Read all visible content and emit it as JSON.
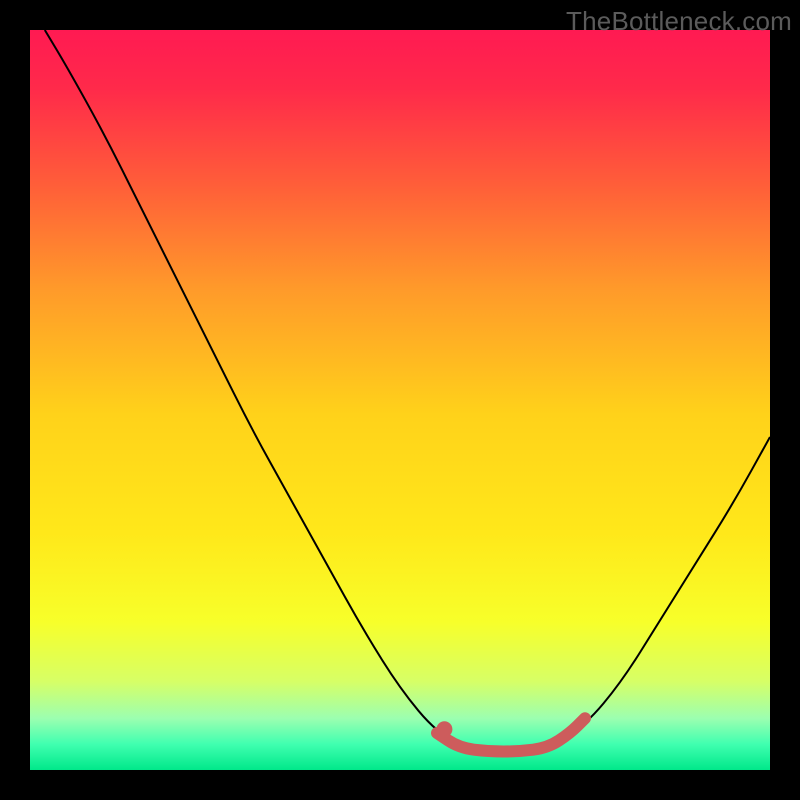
{
  "page": {
    "watermark": "TheBottleneck.com"
  },
  "chart_data": {
    "type": "line",
    "title": "",
    "xlabel": "",
    "ylabel": "",
    "xlim": [
      0,
      100
    ],
    "ylim": [
      0,
      100
    ],
    "grid": false,
    "axes_visible": false,
    "background": {
      "gradient_stops": [
        {
          "offset": 0.0,
          "color": "#ff1a52"
        },
        {
          "offset": 0.08,
          "color": "#ff2a4a"
        },
        {
          "offset": 0.2,
          "color": "#ff5a3a"
        },
        {
          "offset": 0.35,
          "color": "#ff9a2a"
        },
        {
          "offset": 0.52,
          "color": "#ffd21a"
        },
        {
          "offset": 0.68,
          "color": "#ffe81a"
        },
        {
          "offset": 0.8,
          "color": "#f7ff2a"
        },
        {
          "offset": 0.88,
          "color": "#d7ff66"
        },
        {
          "offset": 0.93,
          "color": "#9cffb0"
        },
        {
          "offset": 0.965,
          "color": "#40ffb0"
        },
        {
          "offset": 1.0,
          "color": "#00e88a"
        }
      ]
    },
    "series": [
      {
        "name": "bottleneck-curve",
        "color": "#000000",
        "width": 2,
        "points": [
          {
            "x": 2,
            "y": 100
          },
          {
            "x": 5,
            "y": 95
          },
          {
            "x": 10,
            "y": 86
          },
          {
            "x": 15,
            "y": 76
          },
          {
            "x": 20,
            "y": 66
          },
          {
            "x": 25,
            "y": 56
          },
          {
            "x": 30,
            "y": 46
          },
          {
            "x": 35,
            "y": 37
          },
          {
            "x": 40,
            "y": 28
          },
          {
            "x": 45,
            "y": 19
          },
          {
            "x": 50,
            "y": 11
          },
          {
            "x": 55,
            "y": 5
          },
          {
            "x": 60,
            "y": 2.5
          },
          {
            "x": 65,
            "y": 2.5
          },
          {
            "x": 70,
            "y": 3
          },
          {
            "x": 75,
            "y": 6
          },
          {
            "x": 80,
            "y": 12
          },
          {
            "x": 85,
            "y": 20
          },
          {
            "x": 90,
            "y": 28
          },
          {
            "x": 95,
            "y": 36
          },
          {
            "x": 100,
            "y": 45
          }
        ]
      },
      {
        "name": "optimal-segment",
        "color": "#cd5c5c",
        "width": 12,
        "linecap": "round",
        "points": [
          {
            "x": 55,
            "y": 5
          },
          {
            "x": 58,
            "y": 3
          },
          {
            "x": 62,
            "y": 2.5
          },
          {
            "x": 66,
            "y": 2.5
          },
          {
            "x": 70,
            "y": 3
          },
          {
            "x": 73,
            "y": 5
          },
          {
            "x": 75,
            "y": 7
          }
        ]
      }
    ],
    "markers": [
      {
        "name": "optimal-dot",
        "x": 56,
        "y": 5.5,
        "r": 8,
        "color": "#cd5c5c"
      }
    ],
    "legend": null
  }
}
